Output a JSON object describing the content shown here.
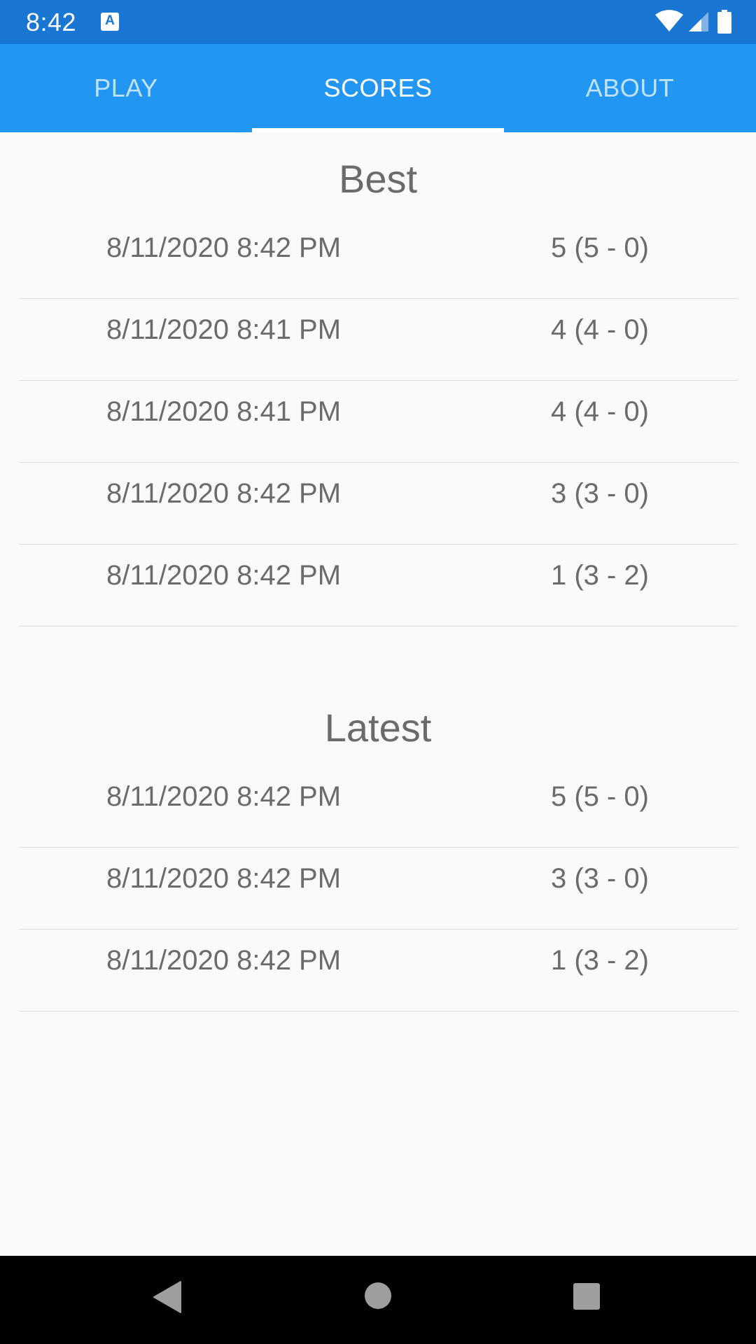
{
  "status_bar": {
    "time": "8:42",
    "app_icon_letter": "A",
    "icons": [
      "wifi-icon",
      "signal-icon",
      "battery-icon"
    ]
  },
  "tabs": [
    {
      "label": "PLAY",
      "active": false
    },
    {
      "label": "SCORES",
      "active": true
    },
    {
      "label": "ABOUT",
      "active": false
    }
  ],
  "best": {
    "title": "Best",
    "rows": [
      {
        "date": "8/11/2020 8:42 PM",
        "score": "5 (5 - 0)"
      },
      {
        "date": "8/11/2020 8:41 PM",
        "score": "4 (4 - 0)"
      },
      {
        "date": "8/11/2020 8:41 PM",
        "score": "4 (4 - 0)"
      },
      {
        "date": "8/11/2020 8:42 PM",
        "score": "3 (3 - 0)"
      },
      {
        "date": "8/11/2020 8:42 PM",
        "score": "1 (3 - 2)"
      }
    ]
  },
  "latest": {
    "title": "Latest",
    "rows": [
      {
        "date": "8/11/2020 8:42 PM",
        "score": "5 (5 - 0)"
      },
      {
        "date": "8/11/2020 8:42 PM",
        "score": "3 (3 - 0)"
      },
      {
        "date": "8/11/2020 8:42 PM",
        "score": "1 (3 - 2)"
      }
    ]
  },
  "nav_bar": {
    "buttons": [
      "back-icon",
      "home-icon",
      "recents-icon"
    ]
  },
  "colors": {
    "status_bar": "#1976d2",
    "tab_bar": "#2196f3",
    "text": "#6b6b6b",
    "background": "#fafafa"
  }
}
